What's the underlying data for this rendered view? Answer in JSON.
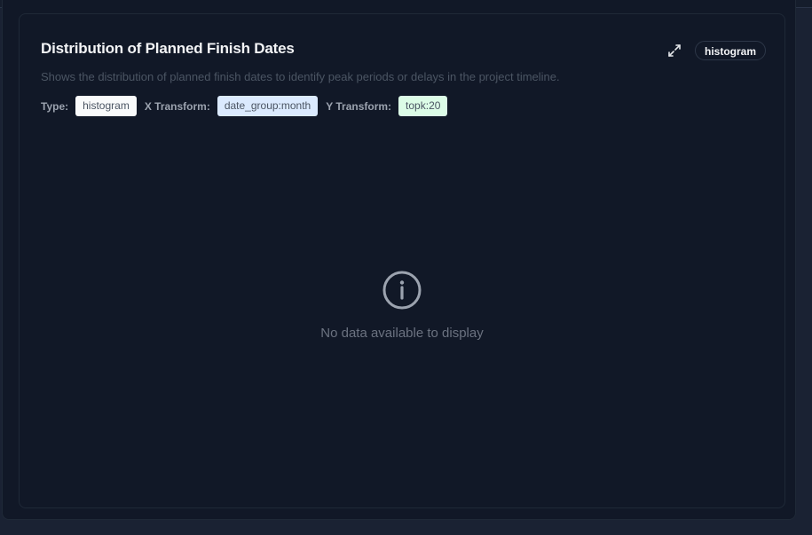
{
  "card": {
    "title": "Distribution of Planned Finish Dates",
    "chart_type_badge": "histogram",
    "description": "Shows the distribution of planned finish dates to identify peak periods or delays in the project timeline.",
    "meta": {
      "type_label": "Type:",
      "type_value": "histogram",
      "x_transform_label": "X Transform:",
      "x_transform_value": "date_group:month",
      "y_transform_label": "Y Transform:",
      "y_transform_value": "topk:20"
    },
    "empty_state": {
      "message": "No data available to display",
      "icon": "info-circle-icon"
    },
    "expand_icon": "expand-icon"
  },
  "colors": {
    "background": "#111827",
    "type_chip": "#f9fafb",
    "x_chip": "#dbeafe",
    "y_chip": "#dcfce7"
  }
}
